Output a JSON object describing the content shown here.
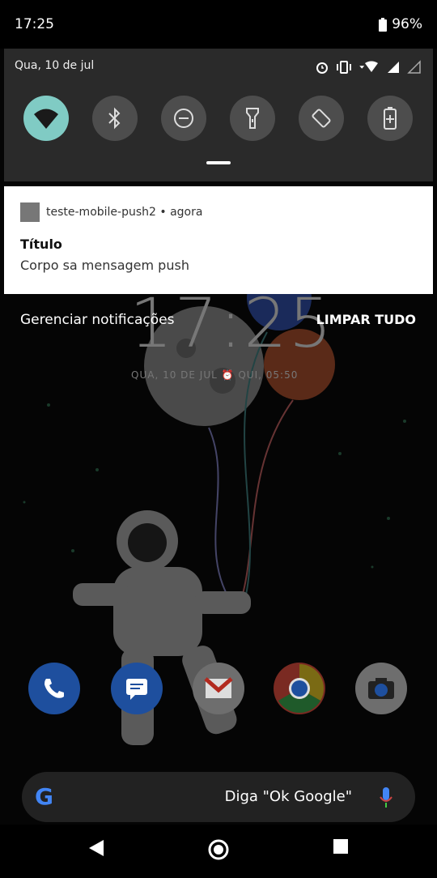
{
  "status": {
    "time": "17:25",
    "battery": "96%"
  },
  "quick_settings": {
    "date": "Qua, 10 de jul",
    "tiles": [
      {
        "name": "wifi",
        "active": true
      },
      {
        "name": "bluetooth",
        "active": false
      },
      {
        "name": "do-not-disturb",
        "active": false
      },
      {
        "name": "flashlight",
        "active": false
      },
      {
        "name": "auto-rotate",
        "active": false
      },
      {
        "name": "battery-saver",
        "active": false
      }
    ]
  },
  "notification": {
    "app": "teste-mobile-push2",
    "separator": "•",
    "time": "agora",
    "title": "Título",
    "body": "Corpo sa mensagem push"
  },
  "notification_actions": {
    "manage": "Gerenciar notificações",
    "clear_all": "LIMPAR TUDO"
  },
  "lockscreen": {
    "clock": "17:25",
    "date_line": "QUA, 10 DE JUL ⏰ QUI, 05:50"
  },
  "dock": [
    "phone-icon",
    "messages-icon",
    "gmail-icon",
    "chrome-icon",
    "camera-icon"
  ],
  "search": {
    "hint": "Diga \"Ok Google\""
  },
  "colors": {
    "accent": "#80cbc4",
    "panel": "#2a2a2a"
  }
}
